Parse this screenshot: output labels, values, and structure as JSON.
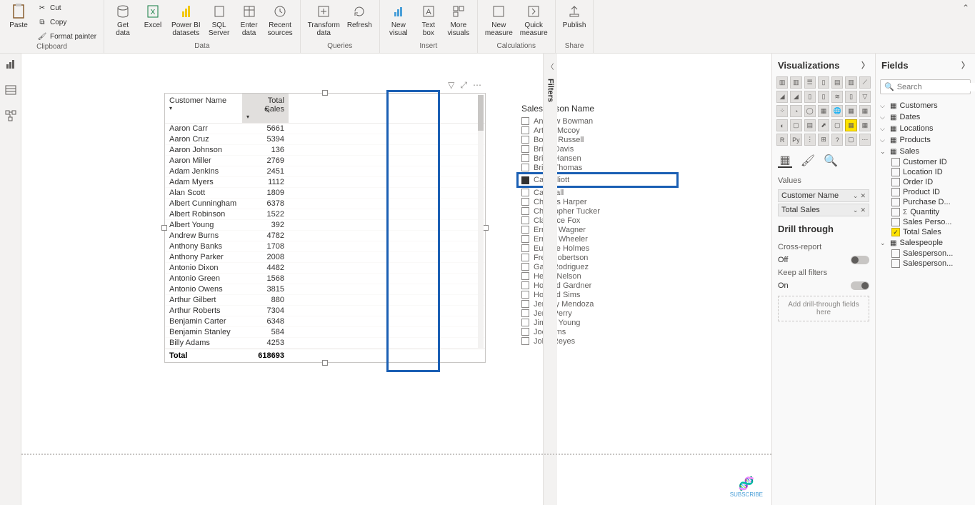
{
  "ribbon": {
    "clipboard": {
      "paste": "Paste",
      "cut": "Cut",
      "copy": "Copy",
      "format_painter": "Format painter",
      "label": "Clipboard"
    },
    "data": {
      "get_data": "Get\ndata",
      "excel": "Excel",
      "powerbi_datasets": "Power BI\ndatasets",
      "sql_server": "SQL\nServer",
      "enter_data": "Enter\ndata",
      "recent_sources": "Recent\nsources",
      "label": "Data"
    },
    "queries": {
      "transform_data": "Transform\ndata",
      "refresh": "Refresh",
      "label": "Queries"
    },
    "insert": {
      "new_visual": "New\nvisual",
      "text_box": "Text\nbox",
      "more_visuals": "More\nvisuals",
      "label": "Insert"
    },
    "calculations": {
      "new_measure": "New\nmeasure",
      "quick_measure": "Quick\nmeasure",
      "label": "Calculations"
    },
    "share": {
      "publish": "Publish",
      "label": "Share"
    }
  },
  "table": {
    "headers": {
      "name": "Customer Name",
      "sales": "Total Sales"
    },
    "rows": [
      {
        "name": "Aaron Carr",
        "sales": "5661"
      },
      {
        "name": "Aaron Cruz",
        "sales": "5394"
      },
      {
        "name": "Aaron Johnson",
        "sales": "136"
      },
      {
        "name": "Aaron Miller",
        "sales": "2769"
      },
      {
        "name": "Adam Jenkins",
        "sales": "2451"
      },
      {
        "name": "Adam Myers",
        "sales": "1112"
      },
      {
        "name": "Alan Scott",
        "sales": "1809"
      },
      {
        "name": "Albert Cunningham",
        "sales": "6378"
      },
      {
        "name": "Albert Robinson",
        "sales": "1522"
      },
      {
        "name": "Albert Young",
        "sales": "392"
      },
      {
        "name": "Andrew Burns",
        "sales": "4782"
      },
      {
        "name": "Anthony Banks",
        "sales": "1708"
      },
      {
        "name": "Anthony Parker",
        "sales": "2008"
      },
      {
        "name": "Antonio Dixon",
        "sales": "4482"
      },
      {
        "name": "Antonio Green",
        "sales": "1568"
      },
      {
        "name": "Antonio Owens",
        "sales": "3815"
      },
      {
        "name": "Arthur Gilbert",
        "sales": "880"
      },
      {
        "name": "Arthur Roberts",
        "sales": "7304"
      },
      {
        "name": "Benjamin Carter",
        "sales": "6348"
      },
      {
        "name": "Benjamin Stanley",
        "sales": "584"
      },
      {
        "name": "Billy Adams",
        "sales": "4253"
      }
    ],
    "total_label": "Total",
    "total_value": "618693"
  },
  "slicer": {
    "title": "Salesperson Name",
    "items": [
      "Andrew Bowman",
      "Arthur Mccoy",
      "Bobby Russell",
      "Brian Davis",
      "Brian Hansen",
      "Brian Thomas",
      "Carl Elliott",
      "Carl Hall",
      "Charles Harper",
      "Christopher Tucker",
      "Clarence Fox",
      "Ernest Wagner",
      "Ernest Wheeler",
      "Eugene Holmes",
      "Fred Robertson",
      "Gary Rodriguez",
      "Henry Nelson",
      "Howard Gardner",
      "Howard Sims",
      "Jeremy Mendoza",
      "Jerry Perry",
      "Jimmy Young",
      "Joe Sims",
      "John Reyes"
    ],
    "selected_index": 6
  },
  "filters_label": "Filters",
  "viz_pane": {
    "title": "Visualizations",
    "values_label": "Values",
    "values": [
      {
        "name": "Customer Name"
      },
      {
        "name": "Total Sales"
      }
    ],
    "drill_title": "Drill through",
    "cross_report": "Cross-report",
    "off_label": "Off",
    "keep_filters": "Keep all filters",
    "on_label": "On",
    "drill_placeholder": "Add drill-through fields here"
  },
  "fields_pane": {
    "title": "Fields",
    "search_placeholder": "Search",
    "tables": [
      {
        "name": "Customers"
      },
      {
        "name": "Dates"
      },
      {
        "name": "Locations"
      },
      {
        "name": "Products"
      },
      {
        "name": "Sales",
        "expanded": true,
        "fields": [
          {
            "name": "Customer ID",
            "checked": false
          },
          {
            "name": "Location ID",
            "checked": false
          },
          {
            "name": "Order ID",
            "checked": false
          },
          {
            "name": "Product ID",
            "checked": false
          },
          {
            "name": "Purchase D...",
            "checked": false
          },
          {
            "name": "Quantity",
            "checked": false,
            "sigma": true
          },
          {
            "name": "Sales Perso...",
            "checked": false
          },
          {
            "name": "Total Sales",
            "checked": true
          }
        ]
      },
      {
        "name": "Salespeople",
        "expanded": true,
        "fields": [
          {
            "name": "Salesperson...",
            "checked": false
          },
          {
            "name": "Salesperson...",
            "checked": false
          }
        ]
      }
    ]
  },
  "subscribe_label": "SUBSCRIBE"
}
